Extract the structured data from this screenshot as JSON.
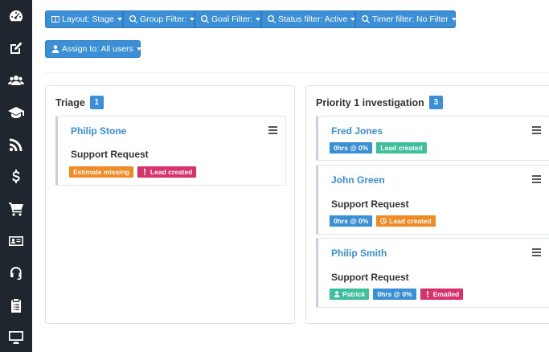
{
  "toolbar": {
    "layout_label": "Layout: Stage",
    "group_label": "Group Filter:",
    "goal_label": "Goal Filter:",
    "status_label": "Status filter: Active",
    "timer_label": "Timer filter: No Filter",
    "assign_label": "Assign to: All users"
  },
  "columns": [
    {
      "title": "Triage",
      "count": "1",
      "cards": [
        {
          "name": "Philip Stone",
          "subject": "Support Request",
          "badges": [
            "Estimate missing",
            "Lead created"
          ]
        }
      ]
    },
    {
      "title": "Priority 1 investigation",
      "count": "3",
      "cards": [
        {
          "name": "Fred Jones",
          "subject": "",
          "badges": [
            "0hrs @ 0%",
            "Lead created"
          ]
        },
        {
          "name": "John Green",
          "subject": "Support Request",
          "badges": [
            "0hrs @ 0%",
            "Lead created"
          ]
        },
        {
          "name": "Philip Smith",
          "subject": "Support Request",
          "badges": [
            "Patrick",
            "0hrs @ 0%",
            "Emailed"
          ]
        }
      ]
    }
  ],
  "colors": {
    "accent": "#3a8fd6",
    "sidebar": "#1f262d",
    "orange": "#f08a24",
    "pink": "#d9326a",
    "teal": "#3fbf9b"
  }
}
